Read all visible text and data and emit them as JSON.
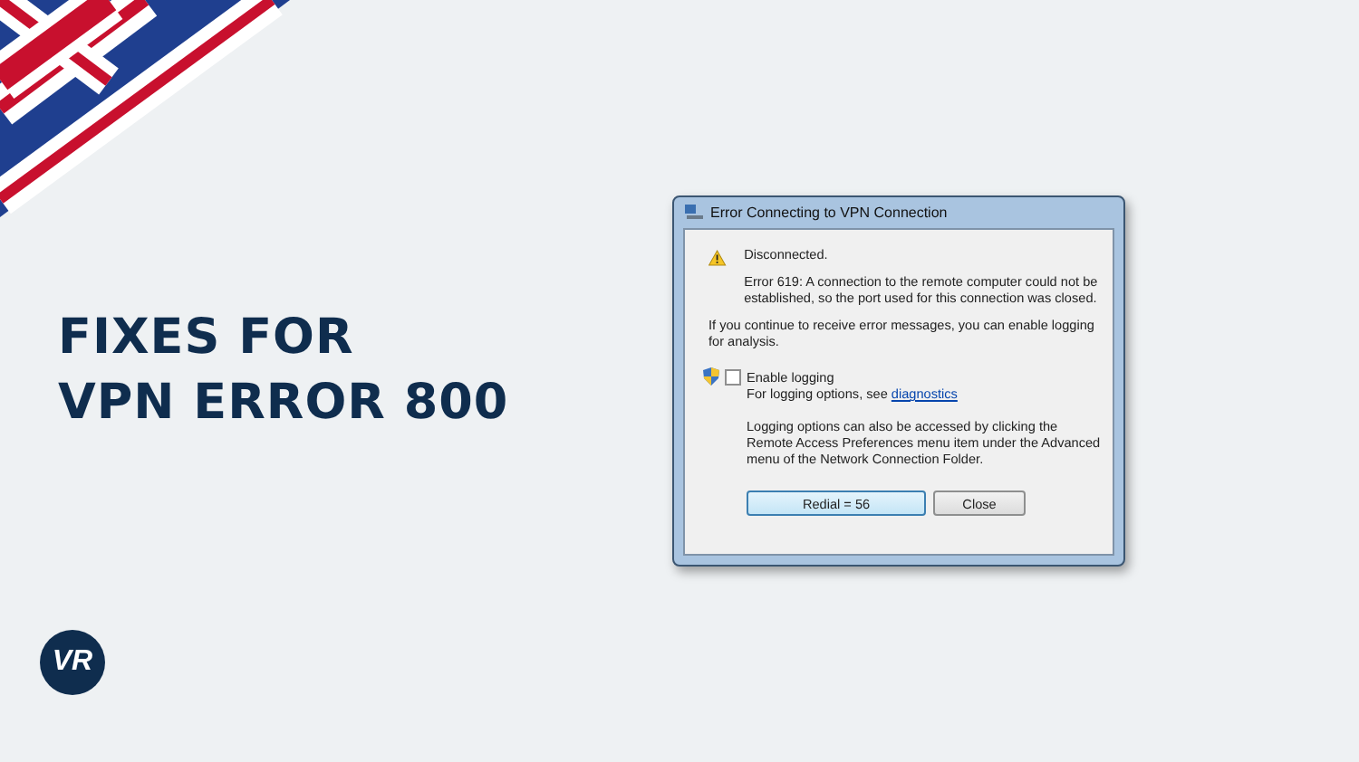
{
  "headline": [
    "FIXES FOR",
    "VPN ERROR 800"
  ],
  "logo": {
    "text": "VR"
  },
  "dialog": {
    "title": "Error Connecting to VPN Connection",
    "status": "Disconnected.",
    "error": "Error 619: A connection to the remote computer could not be established, so the port used for this connection was closed.",
    "advice": "If you continue to receive error messages, you can enable logging for analysis.",
    "logging": {
      "label": "Enable logging",
      "checked": false
    },
    "logging_hint": {
      "text": "For logging options, see",
      "link": "diagnostics"
    },
    "note": "Logging options can also be accessed by clicking the Remote Access Preferences menu item under the Advanced menu of the Network Connection Folder.",
    "buttons": [
      {
        "label": "Redial = 56",
        "selected": true
      },
      {
        "label": "Close",
        "selected": false
      }
    ]
  }
}
